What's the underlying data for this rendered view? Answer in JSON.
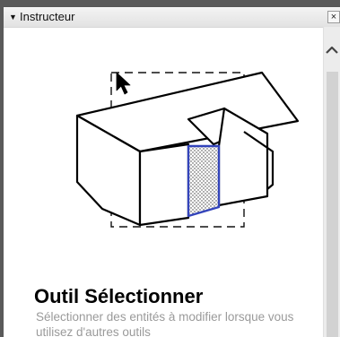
{
  "panel": {
    "title": "Instructeur",
    "collapse_glyph": "▼",
    "close_glyph": "×"
  },
  "tool": {
    "name": "Outil Sélectionner",
    "description": "Sélectionner des entités à modifier lorsque vous utilisez d'autres outils"
  },
  "icons": {
    "collapse": "triangle-down-icon",
    "close": "close-icon",
    "scroll_up": "chevron-up-icon",
    "cursor": "arrow-cursor-icon"
  },
  "colors": {
    "selection": "#3344bb",
    "description_text": "#9a9a9a",
    "panel_background": "#ffffff",
    "window_background": "#5a5a5a"
  }
}
